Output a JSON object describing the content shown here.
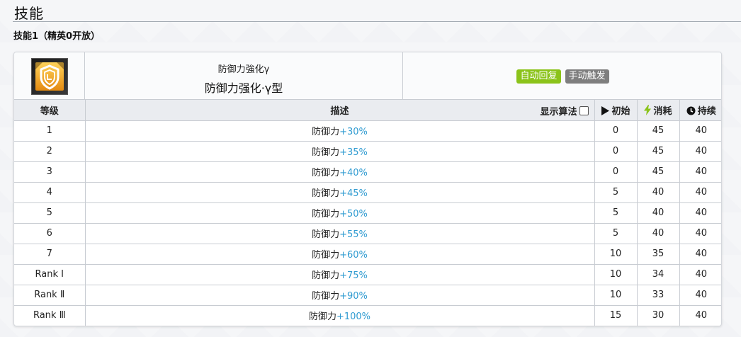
{
  "section_title": "技能",
  "skill_subtitle": "技能1（精英0开放）",
  "skill": {
    "icon": "shield-icon",
    "name_original": "防御力強化γ",
    "name_cn": "防御力强化·γ型",
    "tags": [
      "自动回复",
      "手动触发"
    ],
    "tag_colors": [
      "#8bc31a",
      "#7e7e7e"
    ]
  },
  "table": {
    "headers": {
      "level": "等级",
      "description": "描述",
      "show_algorithm": "显示算法",
      "initial": "初始",
      "cost": "消耗",
      "duration": "持续"
    },
    "header_icons": {
      "initial": "play-icon",
      "cost": "bolt-icon",
      "duration": "clock-icon"
    },
    "rows": [
      {
        "level": "1",
        "desc_prefix": "防御力",
        "desc_value": "+30%",
        "initial": "0",
        "cost": "45",
        "duration": "40"
      },
      {
        "level": "2",
        "desc_prefix": "防御力",
        "desc_value": "+35%",
        "initial": "0",
        "cost": "45",
        "duration": "40"
      },
      {
        "level": "3",
        "desc_prefix": "防御力",
        "desc_value": "+40%",
        "initial": "0",
        "cost": "45",
        "duration": "40"
      },
      {
        "level": "4",
        "desc_prefix": "防御力",
        "desc_value": "+45%",
        "initial": "5",
        "cost": "40",
        "duration": "40"
      },
      {
        "level": "5",
        "desc_prefix": "防御力",
        "desc_value": "+50%",
        "initial": "5",
        "cost": "40",
        "duration": "40"
      },
      {
        "level": "6",
        "desc_prefix": "防御力",
        "desc_value": "+55%",
        "initial": "5",
        "cost": "40",
        "duration": "40"
      },
      {
        "level": "7",
        "desc_prefix": "防御力",
        "desc_value": "+60%",
        "initial": "10",
        "cost": "35",
        "duration": "40"
      },
      {
        "level": "Rank Ⅰ",
        "desc_prefix": "防御力",
        "desc_value": "+75%",
        "initial": "10",
        "cost": "34",
        "duration": "40"
      },
      {
        "level": "Rank Ⅱ",
        "desc_prefix": "防御力",
        "desc_value": "+90%",
        "initial": "10",
        "cost": "33",
        "duration": "40"
      },
      {
        "level": "Rank Ⅲ",
        "desc_prefix": "防御力",
        "desc_value": "+100%",
        "initial": "15",
        "cost": "30",
        "duration": "40"
      }
    ]
  },
  "colors": {
    "highlight": "#2f9bd1",
    "header_bg": "#eaecf0",
    "bolt": "#8bc31a"
  }
}
